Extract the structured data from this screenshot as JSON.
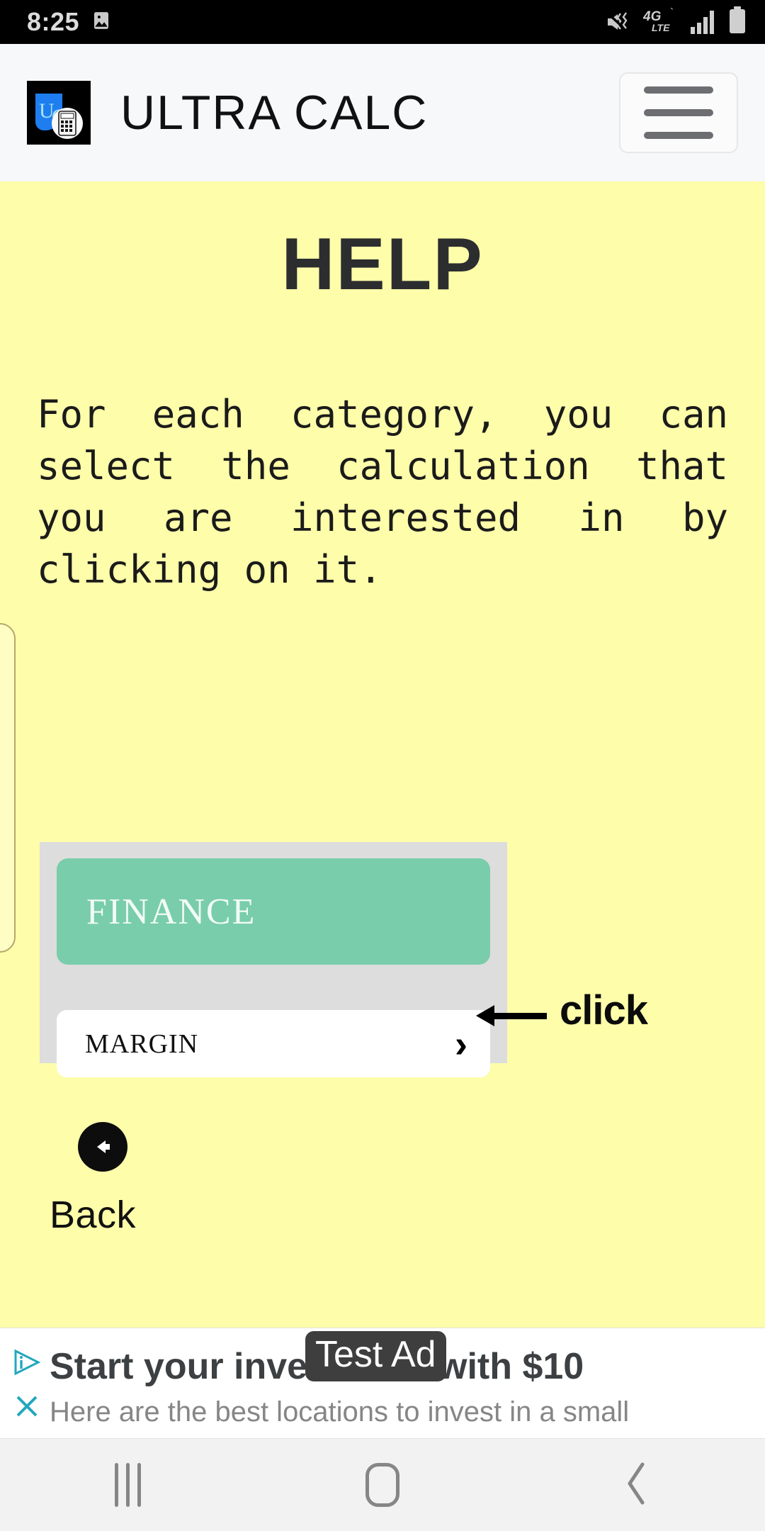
{
  "status_bar": {
    "clock": "8:25",
    "left_icons": [
      "image-icon"
    ],
    "right_icons": [
      "mute-vibrate-icon",
      "4g-lte-icon",
      "signal-bars-icon",
      "battery-icon"
    ],
    "network_label": "4G",
    "network_sub": "LTE"
  },
  "app_bar": {
    "title": "ULTRA CALC",
    "logo_letters": "UC",
    "menu_label": "menu"
  },
  "page": {
    "title": "HELP",
    "body": "For each category, you can select the calculation that you are interested in by clicking on it."
  },
  "illustration": {
    "category_label": "FINANCE",
    "item_label": "MARGIN",
    "chevron": "›",
    "annotation": "click"
  },
  "back": {
    "label": "Back",
    "icon": "arrow-left-circle-icon"
  },
  "ad": {
    "headline": "Start your investment with $10",
    "subtext": "Here are the best locations to invest in a small",
    "badge": "Test Ad",
    "adchoices_icon": "adchoices-icon",
    "close_icon": "close-icon"
  },
  "nav_bar": {
    "recents_label": "Recents",
    "home_label": "Home",
    "back_label": "Back",
    "back_glyph": "‹"
  },
  "colors": {
    "content_bg": "#fdfdaa",
    "app_bar_bg": "#f7f8fa",
    "category_green": "#79cdab",
    "badge_bg": "#3e3e3e",
    "adchoices_teal": "#22a7bd"
  }
}
